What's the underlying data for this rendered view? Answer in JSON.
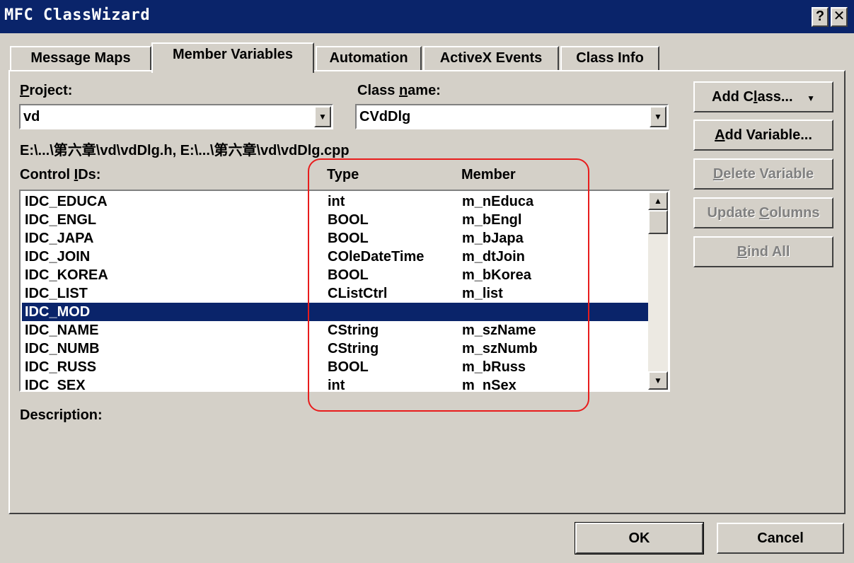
{
  "window": {
    "title": "MFC ClassWizard",
    "help_button": "?",
    "close_button": "✕"
  },
  "tabs": [
    {
      "label": "Message Maps",
      "active": false
    },
    {
      "label": "Member Variables",
      "active": true
    },
    {
      "label": "Automation",
      "active": false
    },
    {
      "label": "ActiveX Events",
      "active": false
    },
    {
      "label": "Class Info",
      "active": false
    }
  ],
  "project": {
    "label_hot": "P",
    "label_rest": "roject:",
    "value": "vd"
  },
  "class_name": {
    "label_pre": "Class ",
    "label_hot": "n",
    "label_rest": "ame:",
    "value": "CVdDlg"
  },
  "file_path": "E:\\...\\第六章\\vd\\vdDlg.h, E:\\...\\第六章\\vd\\vdDlg.cpp",
  "control_ids_label": {
    "pre": "Control ",
    "hot": "I",
    "rest": "Ds:"
  },
  "columns": {
    "type": "Type",
    "member": "Member"
  },
  "rows": [
    {
      "id": "IDC_EDUCA",
      "type": "int",
      "member": "m_nEduca"
    },
    {
      "id": "IDC_ENGL",
      "type": "BOOL",
      "member": "m_bEngl"
    },
    {
      "id": "IDC_JAPA",
      "type": "BOOL",
      "member": "m_bJapa"
    },
    {
      "id": "IDC_JOIN",
      "type": "COleDateTime",
      "member": "m_dtJoin"
    },
    {
      "id": "IDC_KOREA",
      "type": "BOOL",
      "member": "m_bKorea"
    },
    {
      "id": "IDC_LIST",
      "type": "CListCtrl",
      "member": "m_list"
    },
    {
      "id": "IDC_MOD",
      "type": "",
      "member": "",
      "selected": true
    },
    {
      "id": "IDC_NAME",
      "type": "CString",
      "member": "m_szName"
    },
    {
      "id": "IDC_NUMB",
      "type": "CString",
      "member": "m_szNumb"
    },
    {
      "id": "IDC_RUSS",
      "type": "BOOL",
      "member": "m_bRuss"
    },
    {
      "id": "IDC_SEX",
      "type": "int",
      "member": "m_nSex"
    }
  ],
  "description_label": "Description:",
  "side_buttons": {
    "add_class": {
      "pre": "Add C",
      "hot": "l",
      "rest": "ass...",
      "arrow": "▼"
    },
    "add_variable": {
      "pre": "",
      "hot": "A",
      "rest": "dd Variable..."
    },
    "delete_variable": {
      "pre": "",
      "hot": "D",
      "rest": "elete Variable"
    },
    "update_columns": {
      "pre": "Update ",
      "hot": "C",
      "rest": "olumns"
    },
    "bind_all": {
      "pre": "",
      "hot": "B",
      "rest": "ind All"
    }
  },
  "bottom_buttons": {
    "ok": "OK",
    "cancel": "Cancel"
  },
  "colors": {
    "titlebar": "#0a246a",
    "selection": "#0a246a",
    "annotation": "#e81c1c",
    "face": "#d4d0c8"
  }
}
